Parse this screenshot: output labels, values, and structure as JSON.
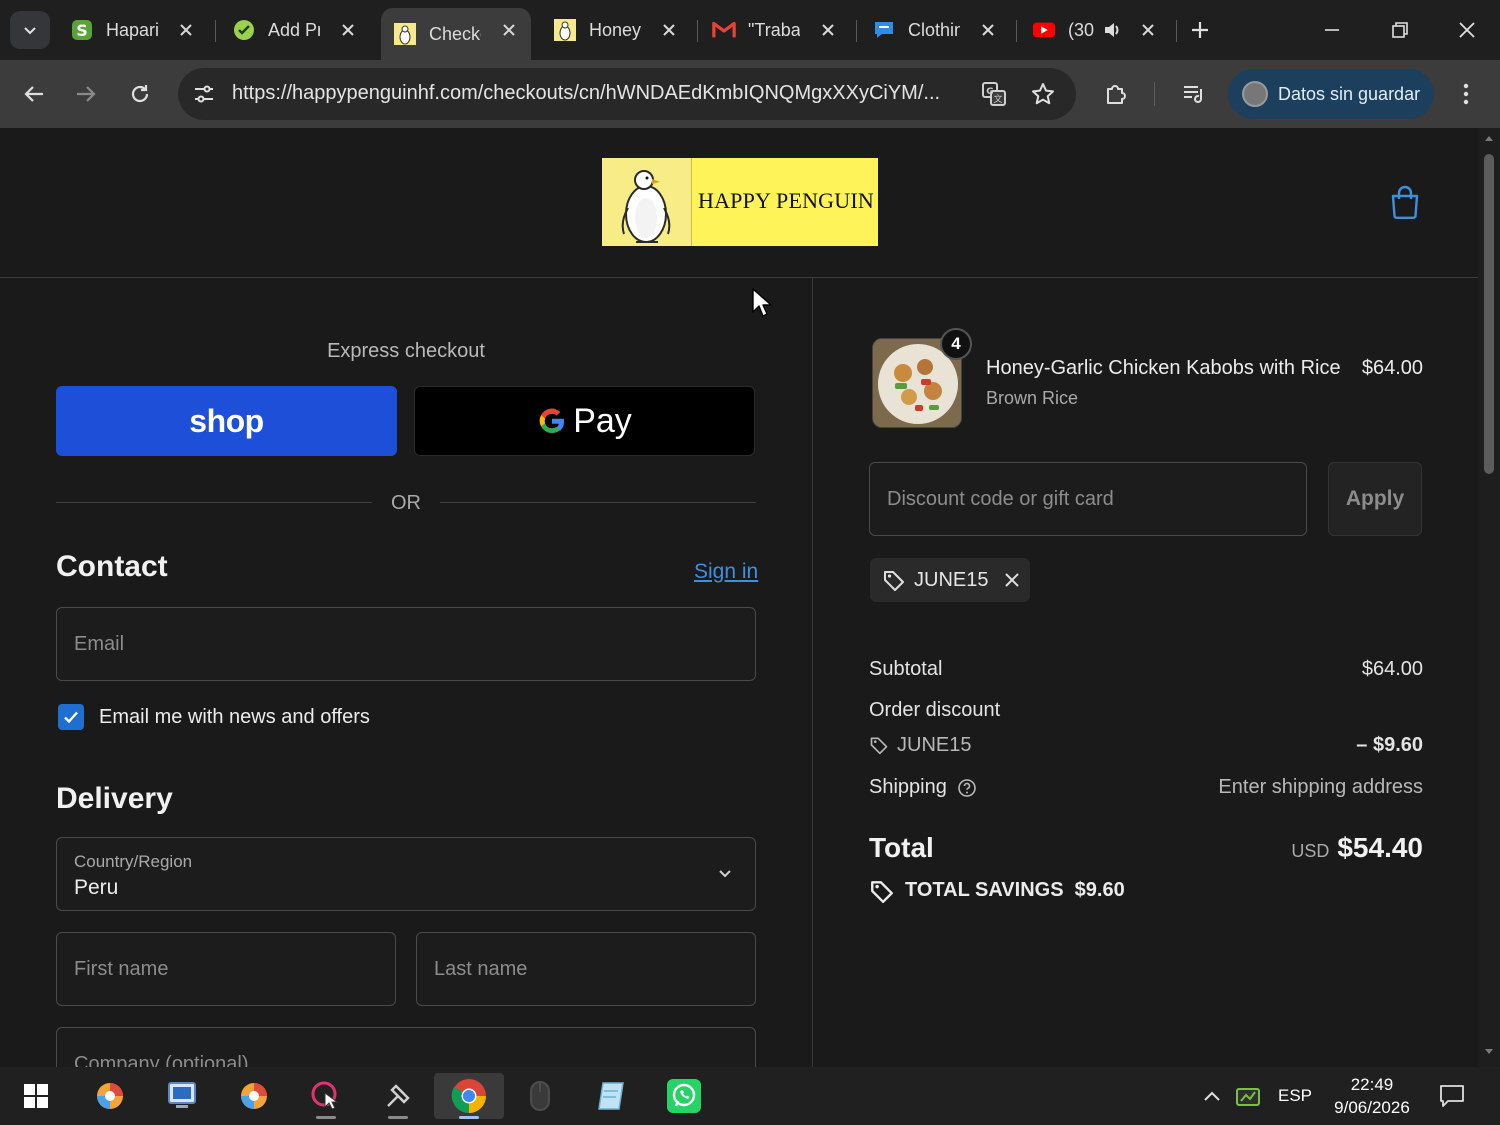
{
  "browser": {
    "tabs": [
      {
        "title": "Hapari",
        "icon": "shopify-icon"
      },
      {
        "title": "Add Pr",
        "icon": "checkmark-leaf-icon"
      },
      {
        "title": "Checko",
        "icon": "penguin-favicon"
      },
      {
        "title": "Honey-",
        "icon": "penguin-favicon"
      },
      {
        "title": "\"Trabaj",
        "icon": "gmail-icon"
      },
      {
        "title": "Clothin",
        "icon": "chat-icon"
      },
      {
        "title": "(30",
        "icon": "youtube-icon"
      }
    ],
    "url": "https://happypenguinhf.com/checkouts/cn/hWNDAEdKmbIQNQMgxXXyCiYM/...",
    "profile_label": "Datos sin guardar"
  },
  "store": {
    "name": "HAPPY PENGUIN"
  },
  "express": {
    "title": "Express checkout",
    "shop_label": "shop",
    "gpay_label": "Pay",
    "or_label": "OR"
  },
  "contact": {
    "title": "Contact",
    "sign_in": "Sign in",
    "email_placeholder": "Email",
    "newsletter_label": "Email me with news and offers",
    "newsletter_checked": true
  },
  "delivery": {
    "title": "Delivery",
    "country_label": "Country/Region",
    "country_value": "Peru",
    "first_name_placeholder": "First name",
    "last_name_placeholder": "Last name",
    "company_placeholder": "Company (optional)"
  },
  "order": {
    "item": {
      "name": "Honey-Garlic Chicken Kabobs with Rice",
      "variant": "Brown Rice",
      "price": "$64.00",
      "quantity": "4"
    },
    "discount_placeholder": "Discount code or gift card",
    "apply_label": "Apply",
    "applied_code": "JUNE15",
    "subtotal_label": "Subtotal",
    "subtotal_value": "$64.00",
    "order_discount_label": "Order discount",
    "discount_code": "JUNE15",
    "discount_value": "– $9.60",
    "shipping_label": "Shipping",
    "shipping_value": "Enter shipping address",
    "total_label": "Total",
    "currency": "USD",
    "total_value": "$54.40",
    "savings_label": "TOTAL SAVINGS",
    "savings_value": "$9.60"
  },
  "taskbar": {
    "language": "ESP",
    "time": "22:49",
    "date": "9/06/2026"
  }
}
